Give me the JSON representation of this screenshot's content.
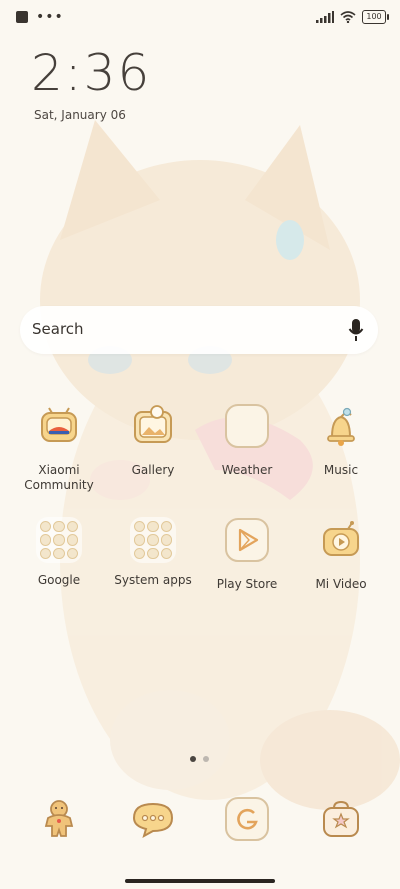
{
  "status_bar": {
    "battery": "100"
  },
  "clock": {
    "time": "2:36",
    "date": "Sat, January 06"
  },
  "search": {
    "label": "Search"
  },
  "apps": [
    {
      "label": "Xiaomi\nCommunity",
      "line1": "Xiaomi",
      "line2": "Community",
      "icon": "tv-icon"
    },
    {
      "label": "Gallery",
      "icon": "gallery-icon"
    },
    {
      "label": "Weather",
      "icon": "weather-icon"
    },
    {
      "label": "Music",
      "icon": "bell-music-icon"
    },
    {
      "label": "Google",
      "icon": "folder-icon"
    },
    {
      "label": "System apps",
      "icon": "folder-icon"
    },
    {
      "label": "Play Store",
      "icon": "play-store-icon"
    },
    {
      "label": "Mi Video",
      "icon": "video-icon"
    }
  ],
  "dock": [
    {
      "icon": "gingerbread-icon"
    },
    {
      "icon": "chat-bubble-icon"
    },
    {
      "icon": "google-icon"
    },
    {
      "icon": "toolbox-icon"
    }
  ],
  "colors": {
    "accent": "#e8b25c",
    "icon_outline": "#c9a472",
    "background": "#fbf8f1"
  }
}
